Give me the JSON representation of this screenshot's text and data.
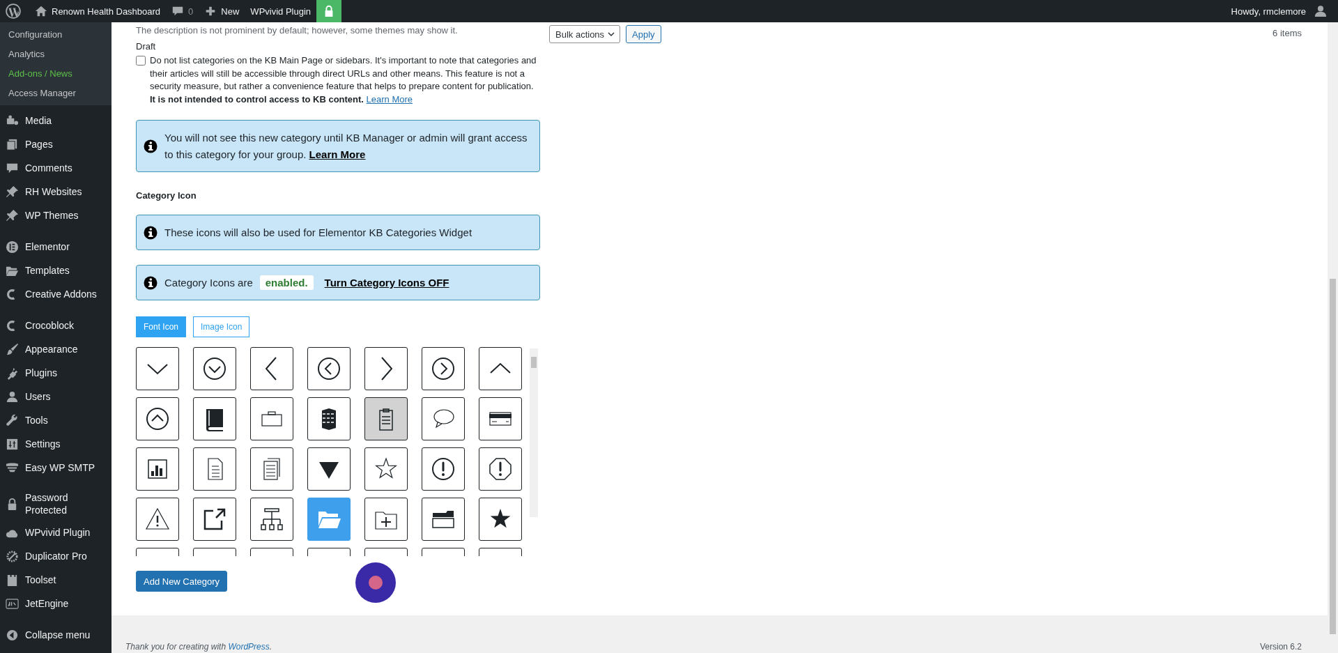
{
  "admin_bar": {
    "site_name": "Renown Health Dashboard",
    "comments_count": "0",
    "new_label": "New",
    "plugin_link": "WPvivid Plugin",
    "greeting": "Howdy, rmclemore"
  },
  "sidebar": {
    "submenu": [
      {
        "label": "Configuration",
        "current": false
      },
      {
        "label": "Analytics",
        "current": false
      },
      {
        "label": "Add-ons / News",
        "current": true
      },
      {
        "label": "Access Manager",
        "current": false
      }
    ],
    "groups": [
      [
        {
          "label": "Media"
        },
        {
          "label": "Pages"
        },
        {
          "label": "Comments"
        },
        {
          "label": "RH Websites"
        },
        {
          "label": "WP Themes"
        }
      ],
      [
        {
          "label": "Elementor"
        },
        {
          "label": "Templates"
        },
        {
          "label": "Creative Addons"
        }
      ],
      [
        {
          "label": "Crocoblock"
        },
        {
          "label": "Appearance"
        },
        {
          "label": "Plugins"
        },
        {
          "label": "Users"
        },
        {
          "label": "Tools"
        },
        {
          "label": "Settings"
        },
        {
          "label": "Easy WP SMTP"
        }
      ],
      [
        {
          "label": "Password Protected"
        },
        {
          "label": "WPvivid Plugin"
        },
        {
          "label": "Duplicator Pro"
        },
        {
          "label": "Toolset"
        },
        {
          "label": "JetEngine"
        }
      ]
    ],
    "collapse_label": "Collapse menu"
  },
  "content": {
    "description_note": "The description is not prominent by default; however, some themes may show it.",
    "draft": {
      "label": "Draft",
      "checked": false,
      "text": "Do not list categories on the KB Main Page or sidebars. It's important to note that categories and their articles will still be accessible through direct URLs and other means. This feature is not a security measure, but rather a convenience feature that helps to prepare content for publication. **It is not intended to control access to KB content.**",
      "link": "Learn More"
    },
    "access_notice": {
      "text": "You will not see this new category until KB Manager or admin will grant access to this category for your group.",
      "link": "Learn More"
    },
    "icon_heading": "Category Icon",
    "widget_notice": "These icons will also be used for Elementor KB Categories Widget",
    "status_notice": {
      "text": "Category Icons are",
      "status": "enabled.",
      "link": "Turn Category Icons OFF"
    },
    "tabs": [
      {
        "label": "Font Icon",
        "selected": true
      },
      {
        "label": "Image Icon",
        "selected": false
      }
    ],
    "icons": [
      {
        "kind": "chevron-down",
        "selected": false,
        "highlighted": false
      },
      {
        "kind": "circle-chevron-down",
        "selected": false,
        "highlighted": false
      },
      {
        "kind": "chevron-left",
        "selected": false,
        "highlighted": false
      },
      {
        "kind": "circle-chevron-left",
        "selected": false,
        "highlighted": false
      },
      {
        "kind": "chevron-right",
        "selected": false,
        "highlighted": false
      },
      {
        "kind": "circle-chevron-right",
        "selected": false,
        "highlighted": false
      },
      {
        "kind": "chevron-up",
        "selected": false,
        "highlighted": false
      },
      {
        "kind": "circle-chevron-up",
        "selected": false,
        "highlighted": false
      },
      {
        "kind": "book",
        "selected": false,
        "highlighted": false
      },
      {
        "kind": "briefcase",
        "selected": false,
        "highlighted": false
      },
      {
        "kind": "building",
        "selected": false,
        "highlighted": false
      },
      {
        "kind": "clipboard",
        "selected": false,
        "highlighted": true
      },
      {
        "kind": "speech-bubble",
        "selected": false,
        "highlighted": false
      },
      {
        "kind": "credit-card",
        "selected": false,
        "highlighted": false
      },
      {
        "kind": "bar-chart",
        "selected": false,
        "highlighted": false
      },
      {
        "kind": "document",
        "selected": false,
        "highlighted": false
      },
      {
        "kind": "documents",
        "selected": false,
        "highlighted": false
      },
      {
        "kind": "triangle-down",
        "selected": false,
        "highlighted": false
      },
      {
        "kind": "star-outline",
        "selected": false,
        "highlighted": false
      },
      {
        "kind": "exclamation-circle",
        "selected": false,
        "highlighted": false
      },
      {
        "kind": "exclamation-octagon",
        "selected": false,
        "highlighted": false
      },
      {
        "kind": "warning",
        "selected": false,
        "highlighted": false
      },
      {
        "kind": "external-link",
        "selected": false,
        "highlighted": false
      },
      {
        "kind": "sitemap",
        "selected": false,
        "highlighted": false
      },
      {
        "kind": "folder-open",
        "selected": true,
        "highlighted": false
      },
      {
        "kind": "folder-plus",
        "selected": false,
        "highlighted": false
      },
      {
        "kind": "folder",
        "selected": false,
        "highlighted": false
      },
      {
        "kind": "star",
        "selected": false,
        "highlighted": false
      },
      {
        "kind": "hidden",
        "selected": false,
        "highlighted": false
      },
      {
        "kind": "hidden",
        "selected": false,
        "highlighted": false
      },
      {
        "kind": "hidden",
        "selected": false,
        "highlighted": false
      },
      {
        "kind": "hidden",
        "selected": false,
        "highlighted": false
      },
      {
        "kind": "hidden",
        "selected": false,
        "highlighted": false
      },
      {
        "kind": "hidden",
        "selected": false,
        "highlighted": false
      },
      {
        "kind": "hidden",
        "selected": false,
        "highlighted": false
      }
    ],
    "add_button": "Add New Category"
  },
  "list_controls": {
    "bulk_actions": "Bulk actions",
    "apply": "Apply",
    "count": "6 items"
  },
  "footer": {
    "thanks": "Thank you for creating with",
    "link": "WordPress",
    "period": ".",
    "version": "Version 6.2"
  }
}
